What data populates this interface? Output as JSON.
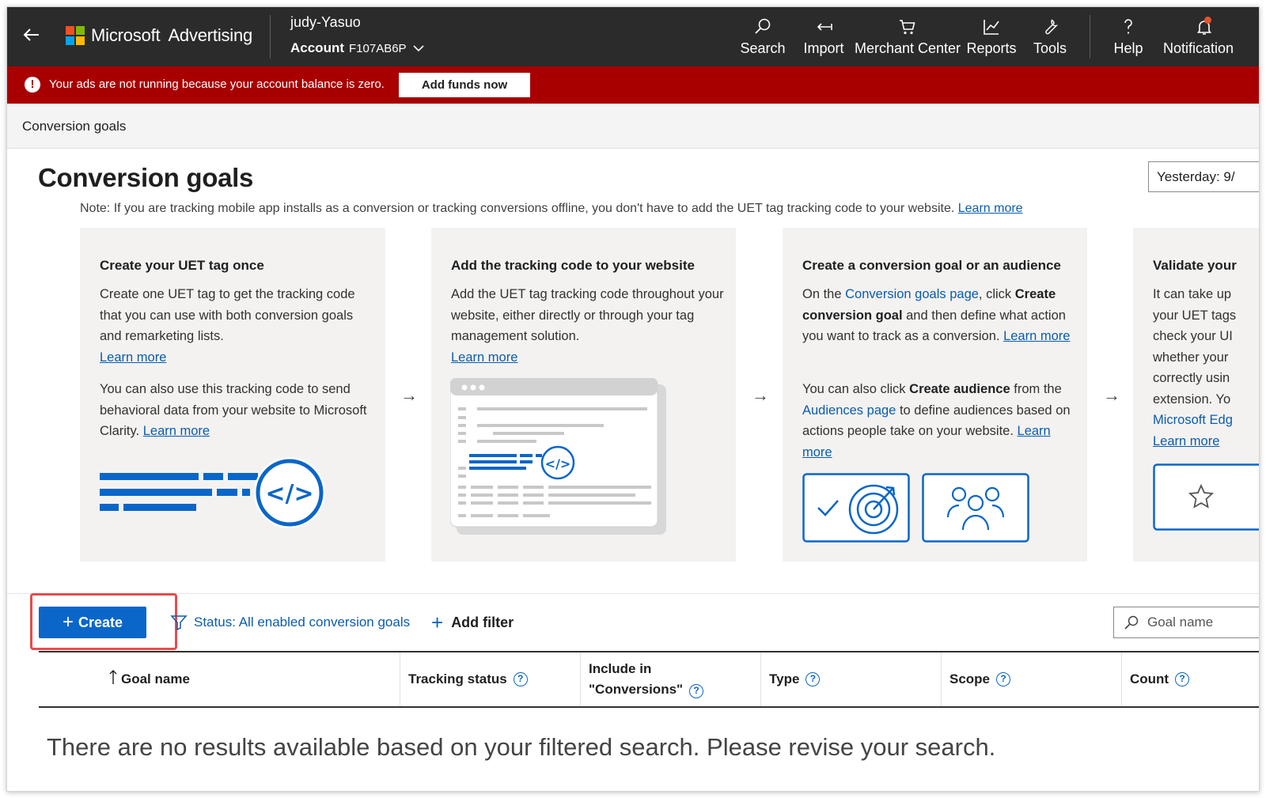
{
  "header": {
    "logo_microsoft": "Microsoft",
    "logo_advertising": "Advertising",
    "user": "judy-Yasuo",
    "account_label": "Account",
    "account_number": "F107AB6P",
    "nav": [
      {
        "label": "Search",
        "icon": "search-icon"
      },
      {
        "label": "Import",
        "icon": "import-icon"
      },
      {
        "label": "Merchant Center",
        "icon": "cart-icon"
      },
      {
        "label": "Reports",
        "icon": "chart-icon"
      },
      {
        "label": "Tools",
        "icon": "wrench-icon"
      },
      {
        "label": "Help",
        "icon": "help-icon"
      },
      {
        "label": "Notification",
        "icon": "bell-icon"
      }
    ]
  },
  "alert": {
    "message": "Your ads are not running because your account balance is zero.",
    "button": "Add funds now"
  },
  "breadcrumb": "Conversion goals",
  "page": {
    "title": "Conversion goals",
    "date_range": "Yesterday: 9/",
    "note": "Note: If you are tracking mobile app installs as a conversion or tracking conversions offline, you don't have to add the UET tag tracking code to your website.",
    "note_link": "Learn more"
  },
  "steps": [
    {
      "title": "Create your UET tag once",
      "p1": "Create one UET tag to get the tracking code that you can use with both conversion goals and remarketing lists.",
      "p1_link": "Learn more",
      "p2": "You can also use this tracking code to send behavioral data from your website to Microsoft Clarity.",
      "p2_link": "Learn more"
    },
    {
      "title": "Add the tracking code to your website",
      "p1": "Add the UET tag tracking code throughout your website, either directly or through your tag management solution.",
      "p1_link": "Learn more"
    },
    {
      "title": "Create a conversion goal or an audience",
      "p1_a": "On the",
      "p1_link_a": "Conversion goals page",
      "p1_b": ", click",
      "p1_bold": "Create conversion goal",
      "p1_c": "and then define what action you want to track as a conversion.",
      "p1_link": "Learn more",
      "p2_a": "You can also click",
      "p2_bold": "Create audience",
      "p2_b": "from the",
      "p2_link_a": "Audiences page",
      "p2_c": "to define audiences based on actions people take on your website.",
      "p2_link": "Learn more"
    },
    {
      "title": "Validate your",
      "lines": [
        "It can take up",
        "your UET tags",
        "check your UI",
        "whether your",
        "correctly usin",
        "extension. Yo"
      ],
      "link_a": "Microsoft Edg",
      "link_b": "Learn more"
    }
  ],
  "toolbar": {
    "create": "Create",
    "filter": "Status: All enabled conversion goals",
    "add_filter": "Add filter",
    "search_placeholder": "Goal name"
  },
  "table": {
    "columns": [
      {
        "label": "Goal name",
        "help": false
      },
      {
        "label": "Tracking status",
        "help": true
      },
      {
        "label_1": "Include in",
        "label_2": "\"Conversions\"",
        "help": true
      },
      {
        "label": "Type",
        "help": true
      },
      {
        "label": "Scope",
        "help": true
      },
      {
        "label": "Count",
        "help": true
      }
    ],
    "empty_message": "There are no results available based on your filtered search. Please revise your search."
  },
  "colors": {
    "topbar": "#2b2b2b",
    "alert": "#a80000",
    "primary": "#0a66c8",
    "link": "#0b5cad",
    "highlight": "#e84b4b"
  }
}
